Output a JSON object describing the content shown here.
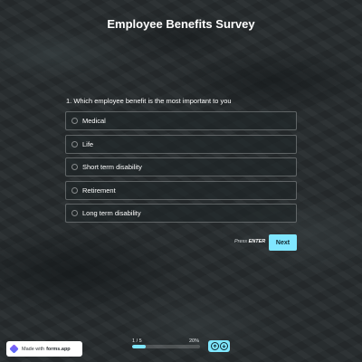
{
  "survey": {
    "title": "Employee Benefits Survey",
    "question": "1.  Which employee benefit is the most important to you",
    "options": [
      "Medical",
      "Life",
      "Short term disability",
      "Retirement",
      "Long term disability"
    ]
  },
  "actions": {
    "press_label": "Press",
    "press_key": "ENTER",
    "next_label": "Next"
  },
  "footer": {
    "made_with": "Made with",
    "brand": "forms.app",
    "progress_count": "1 / 5",
    "progress_percent": "20%",
    "progress_value": 0.2
  },
  "colors": {
    "accent": "#7fe6ff",
    "background": "#272c2e"
  },
  "icons": {
    "brand": "forms-app-logo-icon",
    "up": "arrow-up-icon",
    "down": "arrow-down-icon"
  }
}
